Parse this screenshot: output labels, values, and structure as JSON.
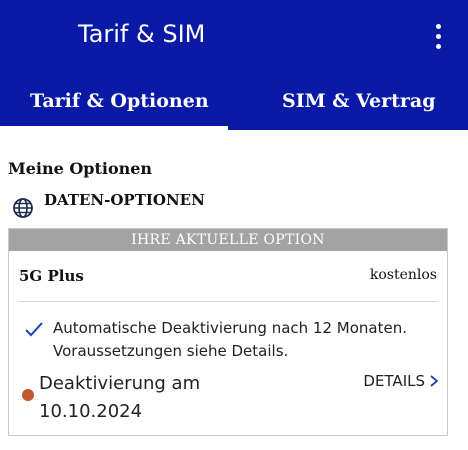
{
  "appbar": {
    "title": "Tarif & SIM",
    "menu_icon": "more-vert-icon",
    "color": "#0a1aa7"
  },
  "tabs": [
    {
      "label": "Tarif & Optionen",
      "selected": true
    },
    {
      "label": "SIM & Vertrag",
      "selected": false
    }
  ],
  "main": {
    "section_title": "Meine Optionen",
    "category": {
      "icon": "globe-icon",
      "label": "DATEN-OPTIONEN"
    },
    "card": {
      "header": "IHRE AKTUELLE OPTION",
      "option_name": "5G Plus",
      "price": "kostenlos",
      "info_icon": "check-icon",
      "info_text": "Automatische Deaktivierung nach 12 Monaten. Voraussetzungen siehe Details.",
      "status_color": "#c4582f",
      "deactivation_text": "Deaktivierung am 10.10.2024",
      "details_label": "DETAILS",
      "details_icon": "chevron-right-icon",
      "accent": "#1a3fb8"
    }
  }
}
